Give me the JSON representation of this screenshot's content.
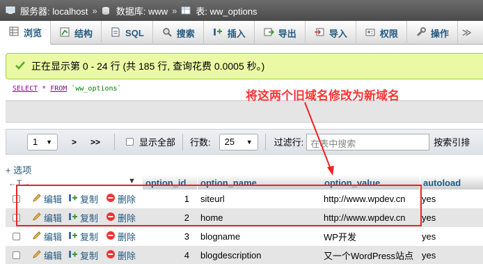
{
  "breadcrumb": {
    "server": "服务器: localhost",
    "database": "数据库: www",
    "table": "表: ww_options",
    "sep": "»"
  },
  "tabs": [
    {
      "label": "浏览",
      "icon": "browse-icon"
    },
    {
      "label": "结构",
      "icon": "structure-icon"
    },
    {
      "label": "SQL",
      "icon": "sql-icon"
    },
    {
      "label": "搜索",
      "icon": "search-icon"
    },
    {
      "label": "插入",
      "icon": "insert-icon"
    },
    {
      "label": "导出",
      "icon": "export-icon"
    },
    {
      "label": "导入",
      "icon": "import-icon"
    },
    {
      "label": "权限",
      "icon": "privileges-icon"
    },
    {
      "label": "操作",
      "icon": "operations-icon"
    }
  ],
  "message": {
    "text": "正在显示第 0 - 24 行 (共 185 行, 查询花费 0.0005 秒。)"
  },
  "sql": {
    "select": "SELECT",
    "star": "*",
    "from": "FROM",
    "table": "`ww_options`"
  },
  "annotation": "将这两个旧域名修改为新域名",
  "nav": {
    "page": "1",
    "next": ">",
    "last": ">>",
    "show_all": "显示全部",
    "rows_label": "行数:",
    "rows_value": "25",
    "filter_label": "过滤行:",
    "filter_placeholder": "在表中搜索",
    "sort_label": "按索引排"
  },
  "options_link": "+ 选项",
  "arrows": "←T→",
  "columns": [
    "option_id",
    "option_name",
    "option_value",
    "autoload"
  ],
  "actions": {
    "edit": "编辑",
    "copy": "复制",
    "delete": "删除"
  },
  "rows": [
    {
      "id": "1",
      "name": "siteurl",
      "value": "http://www.wpdev.cn",
      "autoload": "yes"
    },
    {
      "id": "2",
      "name": "home",
      "value": "http://www.wpdev.cn",
      "autoload": "yes"
    },
    {
      "id": "3",
      "name": "blogname",
      "value": "WP开发",
      "autoload": "yes"
    },
    {
      "id": "4",
      "name": "blogdescription",
      "value": "又一个WordPress站点",
      "autoload": "yes"
    }
  ],
  "colors": {
    "link": "#235a81",
    "annotation": "#ff3333",
    "success_bg": "#ebf8a4"
  }
}
